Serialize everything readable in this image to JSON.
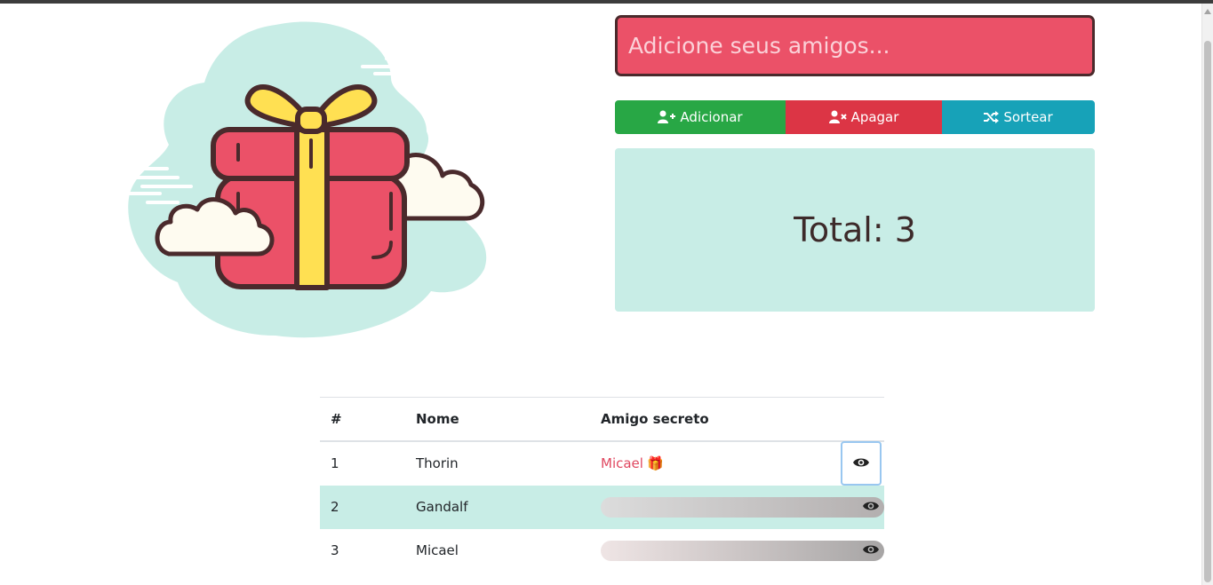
{
  "input": {
    "placeholder": "Adicione seus amigos..."
  },
  "buttons": {
    "add": {
      "label": "Adicionar",
      "icon": "user-plus-icon",
      "color": "#28a745"
    },
    "delete": {
      "label": "Apagar",
      "icon": "user-times-icon",
      "color": "#dc3545"
    },
    "draw": {
      "label": "Sortear",
      "icon": "shuffle-icon",
      "color": "#17a2b8"
    }
  },
  "total": {
    "text": "Total: 3"
  },
  "table": {
    "headers": [
      "#",
      "Nome",
      "Amigo secreto"
    ],
    "rows": [
      {
        "num": "1",
        "name": "Thorin",
        "secret": "Micael",
        "secret_emoji": "🎁",
        "revealed": true
      },
      {
        "num": "2",
        "name": "Gandalf",
        "secret": "",
        "revealed": false
      },
      {
        "num": "3",
        "name": "Micael",
        "secret": "",
        "revealed": false
      }
    ]
  },
  "colors": {
    "input_bg": "#eb5168",
    "total_bg": "#c8ede6",
    "row_highlight": "#c8ede6",
    "revealed_text": "#e04860"
  },
  "illustration": {
    "icon": "gift-box-clouds-illustration"
  }
}
